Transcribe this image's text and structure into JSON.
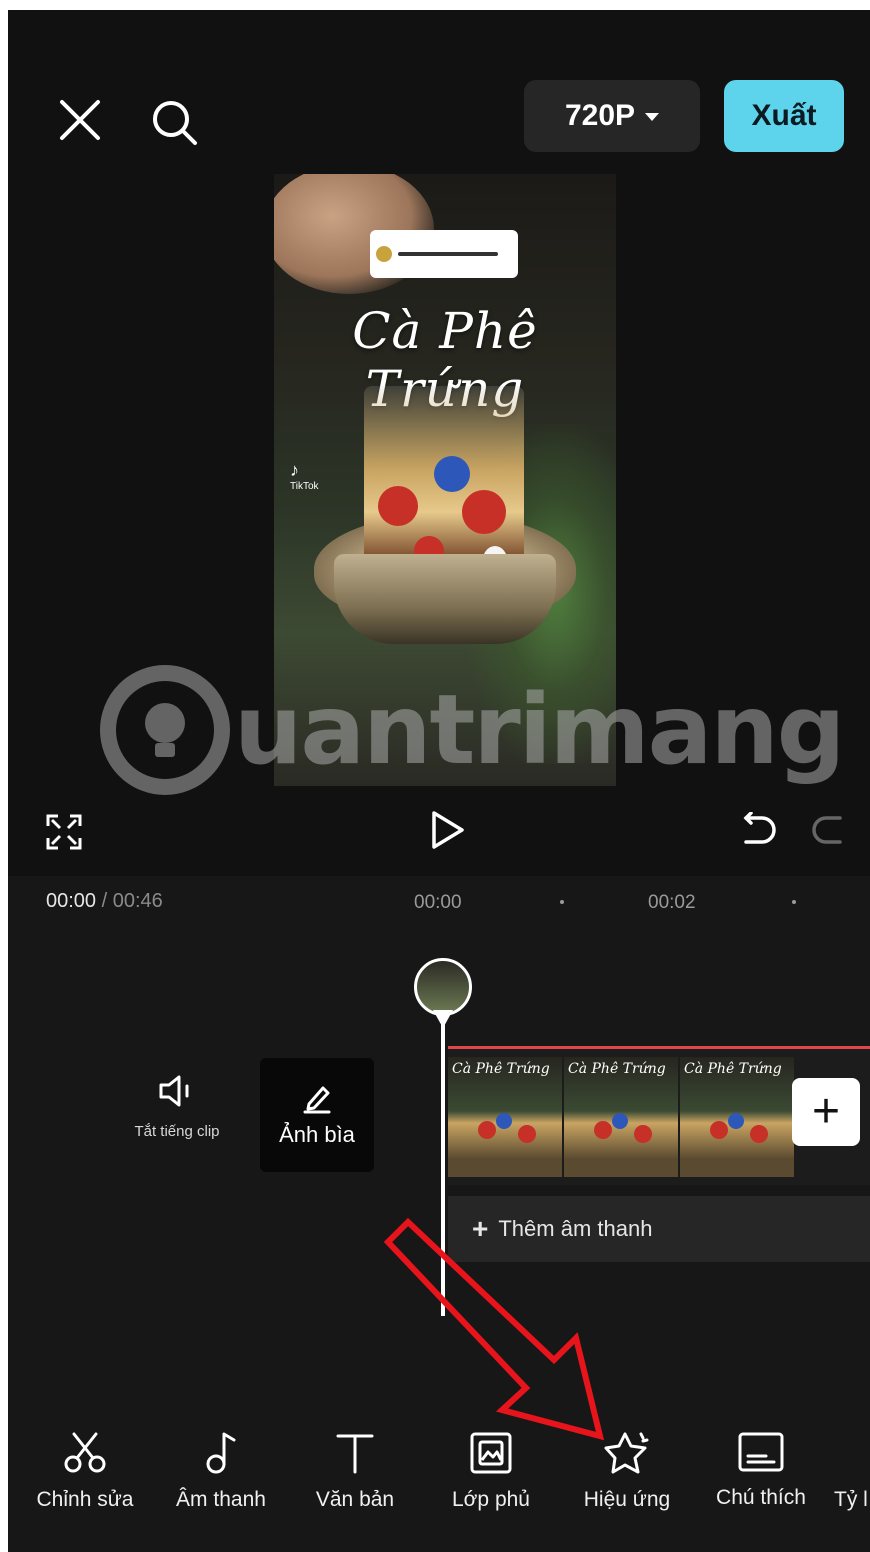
{
  "header": {
    "resolution": "720P",
    "export_label": "Xuất"
  },
  "preview": {
    "video_title": "Cà Phê Trứng",
    "tiktok_label": "TikTok",
    "watermark": "uantrimang"
  },
  "timeline": {
    "current_time": "00:00",
    "separator": " / ",
    "total_time": "00:46",
    "ticks": [
      "00:00",
      "00:02"
    ],
    "mute_label": "Tắt tiếng clip",
    "cover_label": "Ảnh bìa",
    "add_audio_label": "Thêm âm thanh",
    "clip_frame_text": "Cà Phê Trứng"
  },
  "toolbar": {
    "items": [
      {
        "label": "Chỉnh sửa",
        "icon": "scissors-icon"
      },
      {
        "label": "Âm thanh",
        "icon": "music-note-icon"
      },
      {
        "label": "Văn bản",
        "icon": "text-icon"
      },
      {
        "label": "Lớp phủ",
        "icon": "overlay-icon"
      },
      {
        "label": "Hiệu ứng",
        "icon": "star-effect-icon"
      },
      {
        "label": "Chú thích",
        "icon": "caption-icon"
      },
      {
        "label": "Tỷ l",
        "icon": "ratio-icon"
      }
    ]
  },
  "colors": {
    "accent": "#5dd4ec",
    "background": "#111111",
    "annotation_arrow": "#e8141c",
    "clip_border": "#e0474c"
  }
}
